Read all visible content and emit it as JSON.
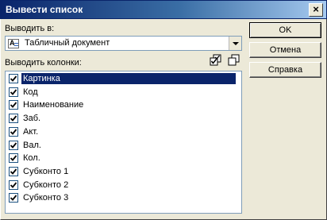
{
  "window": {
    "title": "Вывести список",
    "close_symbol": "×"
  },
  "output": {
    "label": "Выводить в:",
    "selected": "Табличный документ",
    "icon": "spreadsheet-doc-icon"
  },
  "columns": {
    "label": "Выводить колонки:",
    "items": [
      {
        "label": "Картинка",
        "checked": true,
        "selected": true
      },
      {
        "label": "Код",
        "checked": true,
        "selected": false
      },
      {
        "label": "Наименование",
        "checked": true,
        "selected": false
      },
      {
        "label": "Заб.",
        "checked": true,
        "selected": false
      },
      {
        "label": "Акт.",
        "checked": true,
        "selected": false
      },
      {
        "label": "Вал.",
        "checked": true,
        "selected": false
      },
      {
        "label": "Кол.",
        "checked": true,
        "selected": false
      },
      {
        "label": "Субконто 1",
        "checked": true,
        "selected": false
      },
      {
        "label": "Субконто 2",
        "checked": true,
        "selected": false
      },
      {
        "label": "Субконто 3",
        "checked": true,
        "selected": false
      }
    ]
  },
  "buttons": {
    "ok": "OK",
    "cancel": "Отмена",
    "help": "Справка"
  },
  "colors": {
    "selection": "#0A246A",
    "titlebar": "#0A246A",
    "dialog_bg": "#ECE9D8"
  }
}
